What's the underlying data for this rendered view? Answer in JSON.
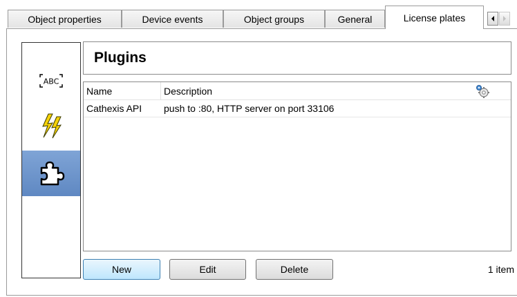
{
  "tabs": [
    {
      "label": "Object properties",
      "active": false
    },
    {
      "label": "Device events",
      "active": false
    },
    {
      "label": "Object groups",
      "active": false
    },
    {
      "label": "General",
      "active": false
    },
    {
      "label": "License plates",
      "active": true
    }
  ],
  "tab_scroll": {
    "left_icon": "scroll-left-arrow-icon",
    "right_icon": "scroll-right-arrow-icon"
  },
  "sidebar": {
    "items": [
      {
        "icon": "abc-text-icon",
        "selected": false
      },
      {
        "icon": "lightning-bolt-icon",
        "selected": false
      },
      {
        "icon": "puzzle-piece-icon",
        "selected": true
      }
    ]
  },
  "panel": {
    "title": "Plugins",
    "list": {
      "columns": [
        "Name",
        "Description"
      ],
      "settings_icon": "gear-settings-icon",
      "rows": [
        {
          "name": "Cathexis API",
          "description": "push to :80, HTTP server on port 33106"
        }
      ]
    },
    "buttons": {
      "new": "New",
      "edit": "Edit",
      "delete": "Delete"
    },
    "item_count": "1 item"
  },
  "colors": {
    "selected_sidebar": "#6b92c9",
    "lightning": "#f5d20a",
    "default_button_border": "#3c7fb1"
  }
}
